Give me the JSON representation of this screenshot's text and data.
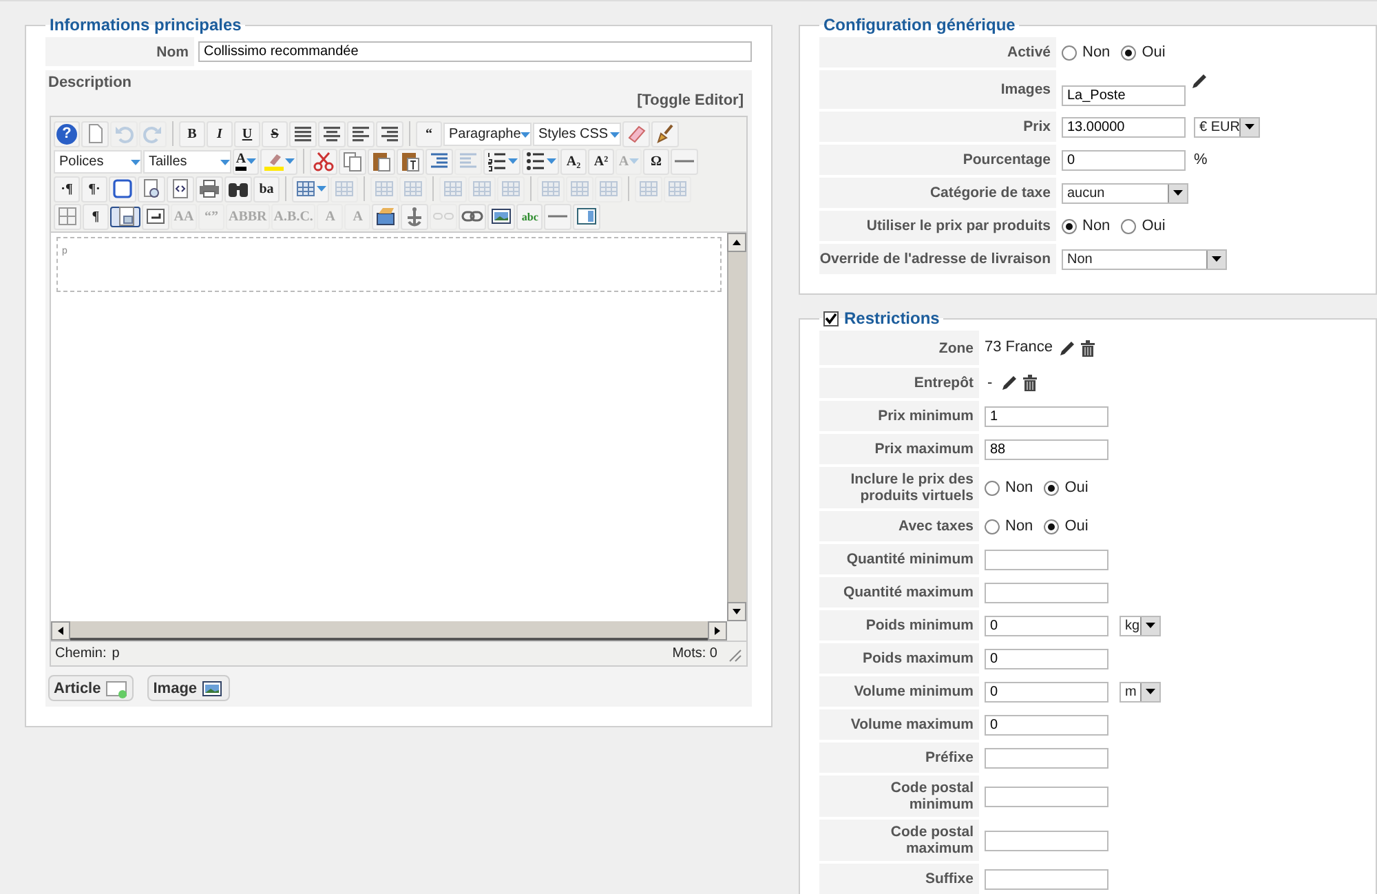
{
  "main_info": {
    "legend": "Informations principales",
    "name_label": "Nom",
    "name_value": "Collissimo recommandée",
    "description_label": "Description",
    "toggle_editor": "[Toggle Editor]",
    "toolbar_rows": [
      [
        {
          "kind": "help",
          "label": "?"
        },
        {
          "kind": "new"
        },
        {
          "kind": "undo",
          "disabled": true
        },
        {
          "kind": "redo",
          "disabled": true
        },
        {
          "kind": "sep"
        },
        {
          "kind": "bold",
          "label": "B"
        },
        {
          "kind": "italic",
          "label": "I"
        },
        {
          "kind": "underline",
          "label": "U"
        },
        {
          "kind": "strike",
          "label": "S"
        },
        {
          "kind": "justify"
        },
        {
          "kind": "center"
        },
        {
          "kind": "left"
        },
        {
          "kind": "right"
        },
        {
          "kind": "sep"
        },
        {
          "kind": "quote",
          "label": "“"
        },
        {
          "kind": "select",
          "label": "Paragraphe"
        },
        {
          "kind": "select",
          "label": "Styles CSS"
        },
        {
          "kind": "eraser"
        },
        {
          "kind": "broom"
        }
      ],
      [
        {
          "kind": "select",
          "label": "Polices"
        },
        {
          "kind": "select",
          "label": "Tailles"
        },
        {
          "kind": "forecolor",
          "label": "A",
          "menu": true
        },
        {
          "kind": "highlight",
          "menu": true
        },
        {
          "kind": "sep"
        },
        {
          "kind": "cut"
        },
        {
          "kind": "copy"
        },
        {
          "kind": "paste"
        },
        {
          "kind": "pastetext"
        },
        {
          "kind": "indent"
        },
        {
          "kind": "outdent",
          "disabled": true
        },
        {
          "kind": "numlist",
          "menu": true
        },
        {
          "kind": "bullist",
          "menu": true
        },
        {
          "kind": "sub",
          "label": "A₂"
        },
        {
          "kind": "sup",
          "label": "A²"
        },
        {
          "kind": "style",
          "label": "A",
          "menu": true,
          "disabled": true
        },
        {
          "kind": "charmap",
          "label": "Ω"
        },
        {
          "kind": "hr"
        }
      ],
      [
        {
          "kind": "ltr",
          "label": "·¶"
        },
        {
          "kind": "rtl",
          "label": "¶·"
        },
        {
          "kind": "fullscreen"
        },
        {
          "kind": "preview"
        },
        {
          "kind": "code"
        },
        {
          "kind": "print"
        },
        {
          "kind": "search"
        },
        {
          "kind": "replace",
          "label": "ba"
        },
        {
          "kind": "sep"
        },
        {
          "kind": "table",
          "menu": true
        },
        {
          "kind": "table",
          "disabled": true
        },
        {
          "kind": "sep"
        },
        {
          "kind": "table",
          "disabled": true
        },
        {
          "kind": "table",
          "disabled": true
        },
        {
          "kind": "sep"
        },
        {
          "kind": "table",
          "disabled": true
        },
        {
          "kind": "table",
          "disabled": true
        },
        {
          "kind": "table",
          "disabled": true
        },
        {
          "kind": "sep"
        },
        {
          "kind": "table",
          "disabled": true
        },
        {
          "kind": "table",
          "disabled": true
        },
        {
          "kind": "table",
          "disabled": true
        },
        {
          "kind": "sep"
        },
        {
          "kind": "table",
          "disabled": true
        },
        {
          "kind": "table",
          "disabled": true
        }
      ],
      [
        {
          "kind": "grid"
        },
        {
          "kind": "pilcrow",
          "label": "¶"
        },
        {
          "kind": "template",
          "selected": true
        },
        {
          "kind": "insert"
        },
        {
          "kind": "styleprops",
          "label": "AA",
          "disabled": true
        },
        {
          "kind": "cite",
          "label": "“”",
          "disabled": true
        },
        {
          "kind": "abbr",
          "label": "ABBR",
          "disabled": true
        },
        {
          "kind": "acronym",
          "label": "A.B.C.",
          "disabled": true
        },
        {
          "kind": "del",
          "label": "A",
          "disabled": true
        },
        {
          "kind": "ins",
          "label": "A",
          "disabled": true
        },
        {
          "kind": "layer"
        },
        {
          "kind": "anchor"
        },
        {
          "kind": "unlink",
          "disabled": true
        },
        {
          "kind": "link"
        },
        {
          "kind": "image"
        },
        {
          "kind": "spell",
          "label": "abc"
        },
        {
          "kind": "hr"
        },
        {
          "kind": "panel"
        }
      ]
    ],
    "editor_content": "p",
    "path_label": "Chemin:",
    "path_value": "p",
    "word_count": "Mots: 0",
    "buttons": [
      {
        "label": "Article",
        "kind": "article"
      },
      {
        "label": "Image",
        "kind": "image"
      }
    ]
  },
  "generic_config": {
    "legend": "Configuration générique",
    "rows": [
      {
        "label": "Activé",
        "kind": "radio",
        "options": [
          {
            "label": "Non",
            "selected": false
          },
          {
            "label": "Oui",
            "selected": true
          }
        ]
      },
      {
        "label": "Images",
        "kind": "text",
        "value": "La_Poste",
        "edit": true
      },
      {
        "label": "Prix",
        "kind": "text",
        "value": "13.00000",
        "unit": "€ EUR"
      },
      {
        "label": "Pourcentage",
        "kind": "text",
        "value": "0",
        "suffix": "%"
      },
      {
        "label": "Catégorie de taxe",
        "kind": "select",
        "value": "aucun"
      },
      {
        "label": "Utiliser le prix par produits",
        "kind": "radio",
        "options": [
          {
            "label": "Non",
            "selected": true
          },
          {
            "label": "Oui",
            "selected": false
          }
        ]
      },
      {
        "label": "Override de l'adresse de livraison",
        "kind": "wide_select",
        "value": "Non"
      }
    ]
  },
  "restrictions": {
    "checked": true,
    "legend": "Restrictions",
    "rows": [
      {
        "label": "Zone",
        "kind": "assigned",
        "value": "73 France"
      },
      {
        "label": "Entrepôt",
        "kind": "assigned",
        "value": "-"
      },
      {
        "label": "Prix minimum",
        "kind": "text",
        "value": "1"
      },
      {
        "label": "Prix maximum",
        "kind": "text",
        "value": "88"
      },
      {
        "label": "Inclure le prix des produits virtuels",
        "kind": "radio",
        "options": [
          {
            "label": "Non",
            "selected": false
          },
          {
            "label": "Oui",
            "selected": true
          }
        ]
      },
      {
        "label": "Avec taxes",
        "kind": "radio",
        "options": [
          {
            "label": "Non",
            "selected": false
          },
          {
            "label": "Oui",
            "selected": true
          }
        ]
      },
      {
        "label": "Quantité minimum",
        "kind": "text"
      },
      {
        "label": "Quantité maximum",
        "kind": "text"
      },
      {
        "label": "Poids minimum",
        "kind": "text",
        "value": "0",
        "unit": "kg"
      },
      {
        "label": "Poids maximum",
        "kind": "text",
        "value": "0"
      },
      {
        "label": "Volume minimum",
        "kind": "text",
        "value": "0",
        "unit": "m"
      },
      {
        "label": "Volume maximum",
        "kind": "text",
        "value": "0"
      },
      {
        "label": "Préfixe",
        "kind": "text"
      },
      {
        "label": "Code postal minimum",
        "kind": "text"
      },
      {
        "label": "Code postal maximum",
        "kind": "text"
      },
      {
        "label": "Suffixe",
        "kind": "text"
      }
    ]
  }
}
